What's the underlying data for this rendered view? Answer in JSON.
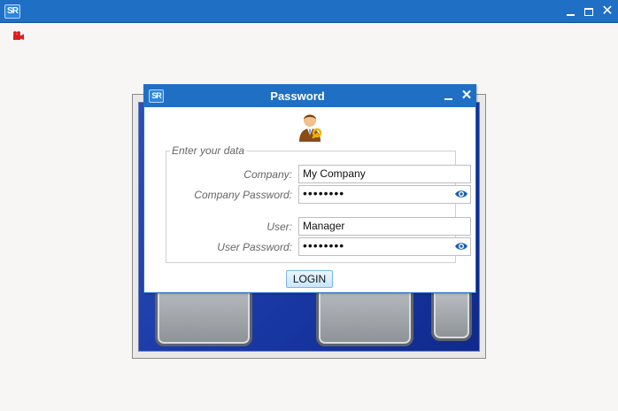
{
  "main_window": {
    "logo_text": "SR",
    "controls": [
      "minimize",
      "maximize",
      "close"
    ]
  },
  "recording_indicator": {
    "icon": "video-camera-icon",
    "color": "#e01b1b"
  },
  "dialog": {
    "logo_text": "SR",
    "title": "Password",
    "icon": "user-key-icon",
    "group_label": "Enter your data",
    "fields": {
      "company_label": "Company:",
      "company_value": "My Company",
      "company_password_label": "Company Password:",
      "company_password_value": "••••••••",
      "user_label": "User:",
      "user_value": "Manager",
      "user_password_label": "User Password:",
      "user_password_value": "••••••••"
    },
    "login_label": "LOGIN"
  },
  "colors": {
    "titlebar": "#1f6fc4",
    "background": "#f7f6f4",
    "splash_blue": "#1b3aa8"
  }
}
